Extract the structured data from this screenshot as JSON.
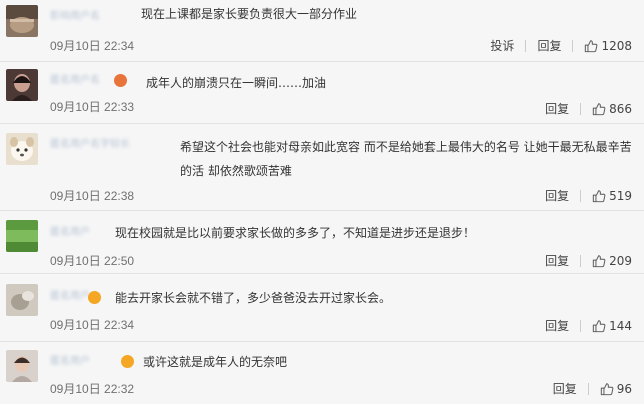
{
  "comments": [
    {
      "name": "影响用户名",
      "text": "现在上课都是家长要负责很大一部分作业",
      "time": "09月10日 22:34",
      "report": "投诉",
      "reply": "回复",
      "likes": "1208",
      "avatar_color": "#6b5a4c"
    },
    {
      "name": "匿名用户名",
      "text": "成年人的崩溃只在一瞬间……加油",
      "time": "09月10日 22:33",
      "reply": "回复",
      "likes": "866",
      "avatar_color": "#3a2d2a"
    },
    {
      "name": "匿名用户名字较长",
      "text": "希望这个社会也能对母亲如此宽容 而不是给她套上最伟大的名号 让她干最无私最辛苦的活 却依然歌颂苦难",
      "time": "09月10日 22:38",
      "reply": "回复",
      "likes": "519",
      "avatar_color": "#e3d5bf"
    },
    {
      "name": "匿名用户",
      "text": "现在校园就是比以前要求家长做的多多了，不知道是进步还是退步！",
      "time": "09月10日 22:50",
      "reply": "回复",
      "likes": "209",
      "avatar_color": "#6aa84f"
    },
    {
      "name": "匿名用户",
      "text": "能去开家长会就不错了，多少爸爸没去开过家长会。",
      "time": "09月10日 22:34",
      "reply": "回复",
      "likes": "144",
      "avatar_color": "#c7c2ba"
    },
    {
      "name": "匿名用户",
      "text": "或许这就是成年人的无奈吧",
      "time": "09月10日 22:32",
      "reply": "回复",
      "likes": "96",
      "avatar_color": "#d8d1cc"
    }
  ],
  "colors": {
    "background": "#f6f6f6",
    "text": "#333333",
    "meta": "#707070",
    "username": "#b9c6d6",
    "badge": "#f5a623"
  }
}
